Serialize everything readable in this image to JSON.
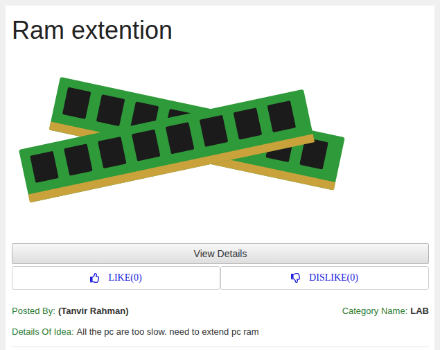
{
  "title": "Ram extention",
  "view_details": {
    "label": "View Details"
  },
  "votes": [
    {
      "kind": "like",
      "label": "LIKE(0)"
    },
    {
      "kind": "dislike",
      "label": "DISLIKE(0)"
    }
  ],
  "posted_by": {
    "label": "Posted By:",
    "value": "(Tanvir Rahman)"
  },
  "category": {
    "label": "Category Name:",
    "value": "LAB"
  },
  "details": {
    "label": "Details Of Idea:",
    "value": "All the pc are too slow. need to extend pc ram"
  }
}
